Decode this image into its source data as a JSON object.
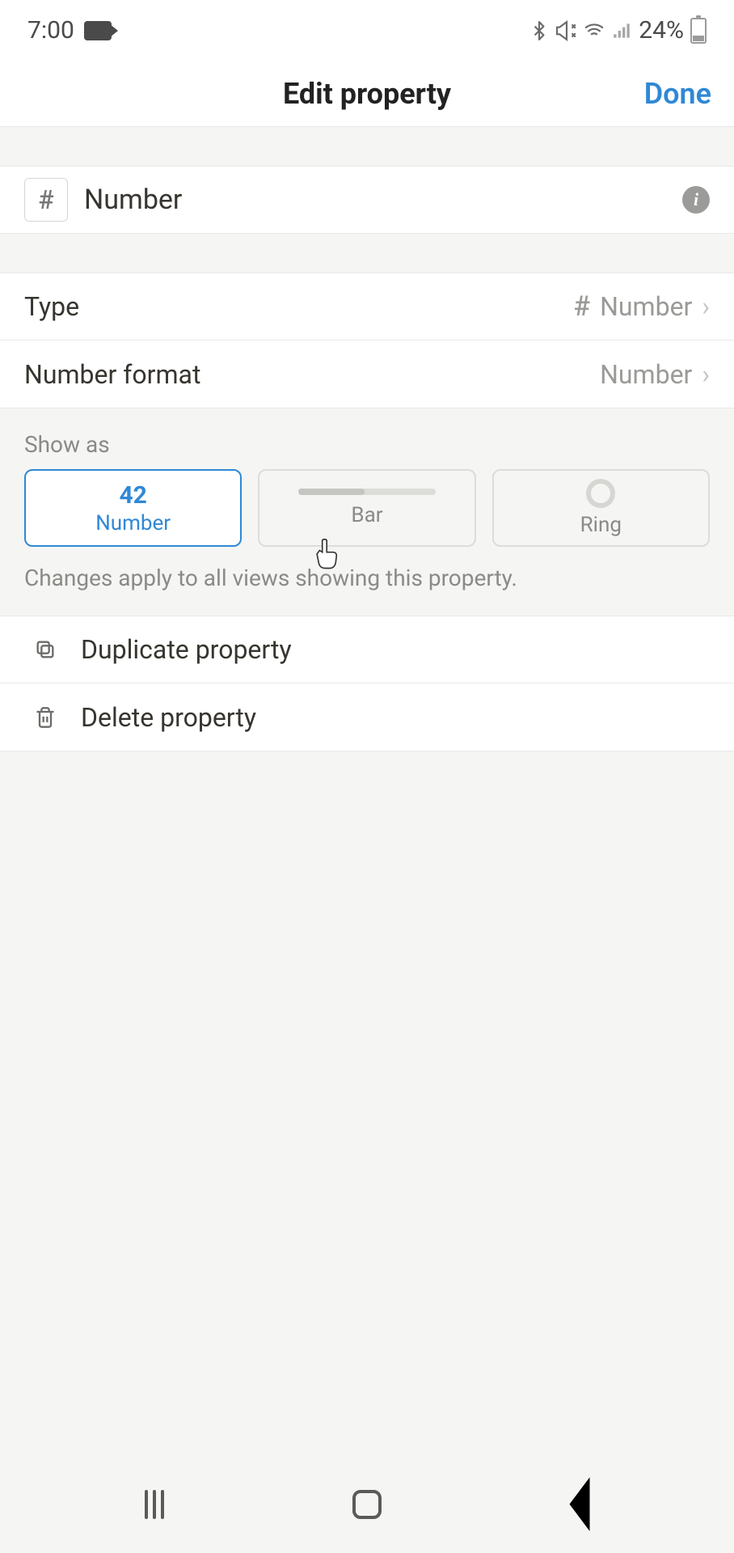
{
  "status": {
    "time": "7:00",
    "battery_pct": "24%"
  },
  "header": {
    "title": "Edit property",
    "done": "Done"
  },
  "name_row": {
    "icon_glyph": "#",
    "name": "Number"
  },
  "type_row": {
    "label": "Type",
    "value_icon": "#",
    "value": "Number"
  },
  "format_row": {
    "label": "Number format",
    "value": "Number"
  },
  "show_as": {
    "label": "Show as",
    "options": [
      {
        "preview": "42",
        "label": "Number",
        "selected": true
      },
      {
        "label": "Bar",
        "selected": false
      },
      {
        "label": "Ring",
        "selected": false
      }
    ],
    "helper": "Changes apply to all views showing this property."
  },
  "actions": {
    "duplicate": "Duplicate property",
    "delete": "Delete property"
  }
}
